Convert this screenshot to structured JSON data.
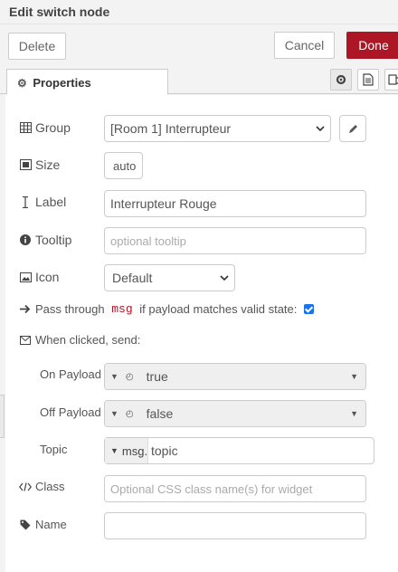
{
  "header": {
    "title": "Edit switch node"
  },
  "buttons": {
    "delete": "Delete",
    "cancel": "Cancel",
    "done": "Done"
  },
  "tabs": {
    "properties": "Properties"
  },
  "form": {
    "group": {
      "label": "Group",
      "value": "[Room 1] Interrupteur"
    },
    "size": {
      "label": "Size",
      "value": "auto"
    },
    "label": {
      "label": "Label",
      "value": "Interrupteur Rouge"
    },
    "tooltip": {
      "label": "Tooltip",
      "placeholder": "optional tooltip"
    },
    "icon": {
      "label": "Icon",
      "value": "Default"
    },
    "passthrough": {
      "pre": "Pass through ",
      "code": "msg",
      "post": " if payload matches valid state:",
      "checked": true
    },
    "when_clicked": {
      "label": "When clicked, send:"
    },
    "on_payload": {
      "label": "On Payload",
      "value": "true"
    },
    "off_payload": {
      "label": "Off Payload",
      "value": "false"
    },
    "topic": {
      "label": "Topic",
      "type": "msg.",
      "value": "topic"
    },
    "class": {
      "label": "Class",
      "placeholder": "Optional CSS class name(s) for widget"
    },
    "name": {
      "label": "Name",
      "value": ""
    }
  },
  "colors": {
    "done_button": "#ad1625",
    "checkbox": "#1a73e8"
  },
  "icons": [
    "cog-icon",
    "description-icon",
    "appearance-icon",
    "table-icon",
    "resize-icon",
    "text-cursor-icon",
    "info-circle-icon",
    "image-icon",
    "arrow-right-icon",
    "envelope-icon",
    "code-icon",
    "tag-icon",
    "pencil-icon",
    "clock-icon"
  ]
}
